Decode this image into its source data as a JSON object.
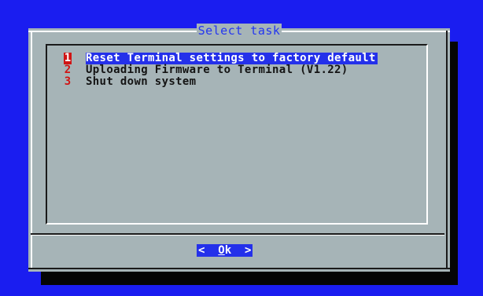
{
  "colors": {
    "background": "#1a1df0",
    "dialog": "#a6b4b7",
    "title_text": "#2436f0",
    "highlight": "#2430ea",
    "hotkey": "#d01414",
    "shadow": "#050505"
  },
  "dialog": {
    "title": "Select task"
  },
  "menu": {
    "items": [
      {
        "key": "1",
        "label": "Reset Terminal settings to factory default",
        "selected": true
      },
      {
        "key": "2",
        "label": "Uploading Firmware to Terminal (V1.22)",
        "selected": false
      },
      {
        "key": "3",
        "label": "Shut down system",
        "selected": false
      }
    ]
  },
  "buttons": {
    "ok": {
      "left": "<  ",
      "hotkey": "O",
      "rest": "k",
      "right": "  >"
    }
  }
}
